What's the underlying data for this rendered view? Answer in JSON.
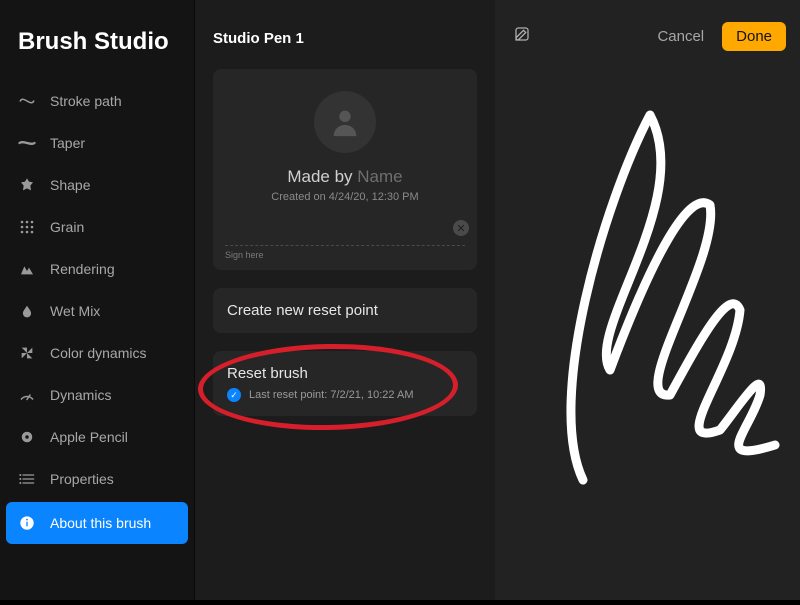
{
  "sidebar": {
    "title": "Brush Studio",
    "items": [
      {
        "label": "Stroke path"
      },
      {
        "label": "Taper"
      },
      {
        "label": "Shape"
      },
      {
        "label": "Grain"
      },
      {
        "label": "Rendering"
      },
      {
        "label": "Wet Mix"
      },
      {
        "label": "Color dynamics"
      },
      {
        "label": "Dynamics"
      },
      {
        "label": "Apple Pencil"
      },
      {
        "label": "Properties"
      },
      {
        "label": "About this brush"
      }
    ]
  },
  "center": {
    "brush_name": "Studio Pen 1",
    "made_by_prefix": "Made by ",
    "made_by_name": "Name",
    "created_on": "Created on 4/24/20, 12:30 PM",
    "sign_here": "Sign here",
    "create_reset_label": "Create new reset point",
    "reset_brush_label": "Reset brush",
    "last_reset_text": "Last reset point: 7/2/21, 10:22 AM"
  },
  "topbar": {
    "cancel": "Cancel",
    "done": "Done"
  }
}
